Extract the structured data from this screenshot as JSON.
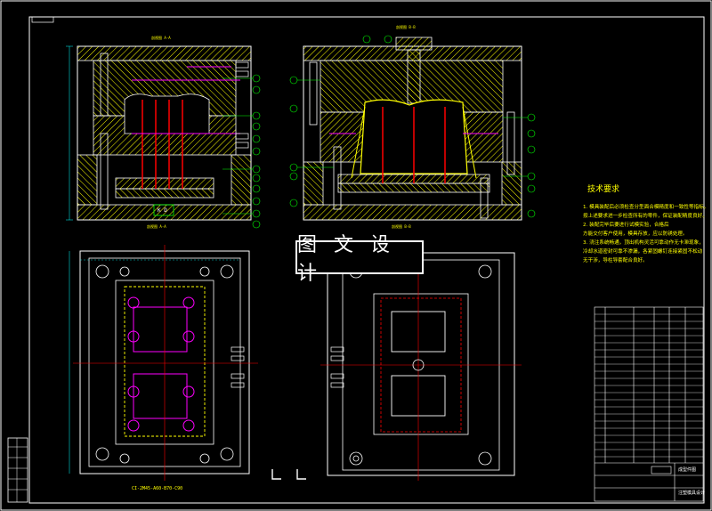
{
  "banner": {
    "text": "图 文 设 计"
  },
  "notes": {
    "title": "技术要求",
    "lines": [
      "1. 模具装配后必须检查分型面合模精度和一致性等指标。",
      "按上述要求进一步检查所有的零件，保证装配精度良好。",
      "2. 装配完毕后要进行试模实验，合格后",
      "方能交付客户使用，模具存放，应以防锈处理。",
      "3. 浇注系统畅通，顶出机构灵活可靠动作无卡滞现象，",
      "冷却水道密封可靠不渗漏，各紧固螺钉连接紧固不松动",
      "无干涉，导柱导套配合良好。"
    ]
  },
  "labels": {
    "section_a": "剖视图 A-A",
    "section_b": "剖视图 B-B",
    "section_top_a": "剖视图 A-A",
    "section_top_b": "剖视图 B-B",
    "mold_spec": "CI-2M45-A60-B70-C90",
    "kd": "K D",
    "title_block_name": "成型件图",
    "title_block_sub": "注塑模具设计"
  },
  "colors": {
    "background": "#000000",
    "outline": "#ffffff",
    "hatch": "#ffff00",
    "section_green": "#00ff00",
    "ejector_red": "#ff0000",
    "centerline": "#ff0000",
    "bolt_magenta": "#ff00ff",
    "dimension_cyan": "#00ffff",
    "part_blue": "#4060ff"
  },
  "parts_callouts_left": [
    "1",
    "2",
    "3",
    "4",
    "5",
    "6",
    "7",
    "8",
    "9",
    "10",
    "11",
    "12",
    "13"
  ],
  "parts_callouts_right": [
    "14",
    "15",
    "16",
    "17",
    "18",
    "19",
    "20",
    "21",
    "22",
    "23",
    "24"
  ]
}
